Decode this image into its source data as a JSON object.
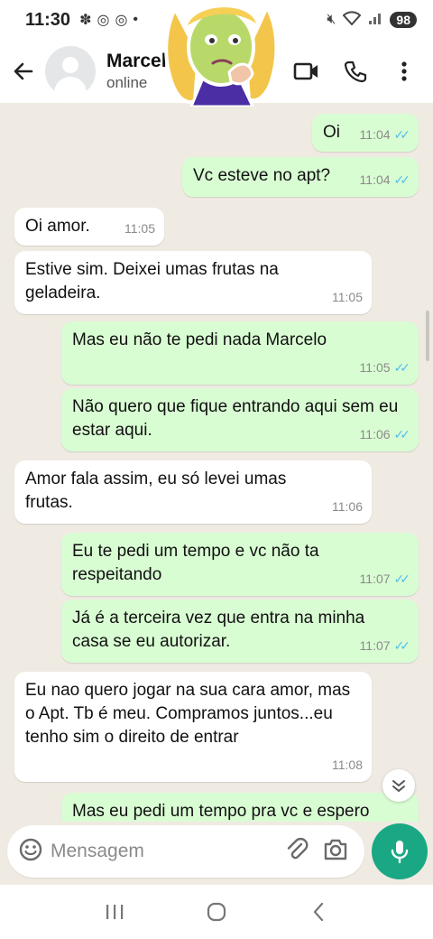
{
  "status_bar": {
    "time": "11:30",
    "battery": "98"
  },
  "header": {
    "contact_name": "Marcel",
    "contact_status": "online"
  },
  "messages": [
    {
      "dir": "out",
      "text": "Oi",
      "time": "11:04",
      "read": true
    },
    {
      "dir": "out",
      "text": "Vc esteve no apt?",
      "time": "11:04",
      "read": true
    },
    {
      "dir": "in",
      "text": "Oi amor.",
      "time": "11:05"
    },
    {
      "dir": "in",
      "text": "Estive sim. Deixei umas frutas na geladeira.",
      "time": "11:05"
    },
    {
      "dir": "out",
      "text": "Mas eu não te pedi nada Marcelo",
      "time": "11:05",
      "read": true
    },
    {
      "dir": "out",
      "text": "Não quero que fique entrando aqui sem eu estar aqui.",
      "time": "11:06",
      "read": true
    },
    {
      "dir": "in",
      "text": "Amor fala assim, eu só levei umas frutas.",
      "time": "11:06"
    },
    {
      "dir": "out",
      "text": "Eu te pedi um tempo e vc não ta respeitando",
      "time": "11:07",
      "read": true
    },
    {
      "dir": "out",
      "text": "Já é a terceira vez que entra na minha casa se eu autorizar.",
      "time": "11:07",
      "read": true
    },
    {
      "dir": "in",
      "text": "Eu nao quero jogar na sua cara  amor, mas o Apt. Tb é meu. Compramos juntos...eu tenho sim o direito de entrar",
      "time": "11:08"
    },
    {
      "dir": "out",
      "text": "Mas eu pedi um tempo pra vc e espero",
      "time": ""
    }
  ],
  "input": {
    "placeholder": "Mensagem"
  },
  "colors": {
    "outgoing": "#d9fdd3",
    "incoming": "#ffffff",
    "background": "#efeae2",
    "accent": "#1aa884",
    "read_ticks": "#53bdeb"
  },
  "icons": [
    "back-arrow-icon",
    "video-call-icon",
    "phone-icon",
    "more-vert-icon",
    "emoji-icon",
    "attach-icon",
    "camera-icon",
    "mic-icon",
    "scroll-down-icon",
    "recent-apps-icon",
    "home-icon",
    "back-nav-icon"
  ]
}
